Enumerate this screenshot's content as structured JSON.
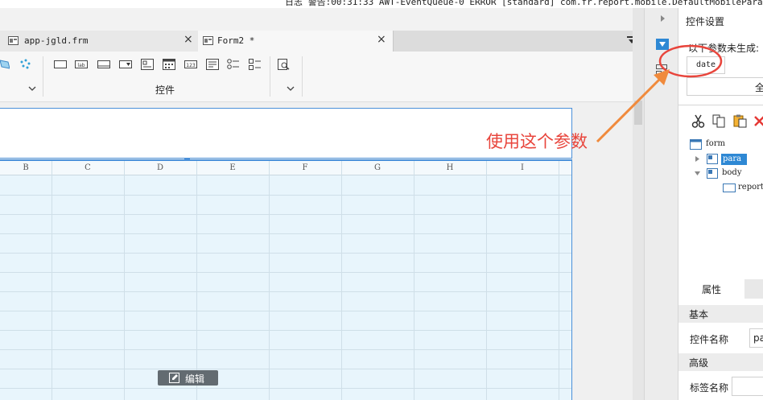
{
  "log": {
    "text": "日志  警告:00:31:33 AWT-EventQueue-0 ERROR [standard] com.fr.report.mobile.DefaultMobileParamStyle"
  },
  "tabs": [
    {
      "label": "app-jgld.frm",
      "active": false
    },
    {
      "label": "Form2 *",
      "active": true
    }
  ],
  "toolbar": {
    "section_label": "控件"
  },
  "columns": [
    "B",
    "C",
    "D",
    "E",
    "F",
    "G",
    "H",
    "I"
  ],
  "canvas": {
    "edit_label": "编辑"
  },
  "right_panel": {
    "title": "控件设置",
    "params_label": "以下参数未生成:",
    "param_chip": "date",
    "generate_all": "全",
    "tree": {
      "root": "form",
      "para": "para",
      "body": "body",
      "report": "report"
    },
    "tab_properties": "属性",
    "section_basic": "基本",
    "field_widget_name": "控件名称",
    "field_widget_value": "pa",
    "section_advanced": "高级",
    "field_label_name": "标签名称"
  },
  "annotation": {
    "text": "使用这个参数",
    "color": "#e8453c"
  },
  "colors": {
    "accent": "#4a90d9",
    "body_bg": "#e8f5fc",
    "delete": "#e53935"
  }
}
